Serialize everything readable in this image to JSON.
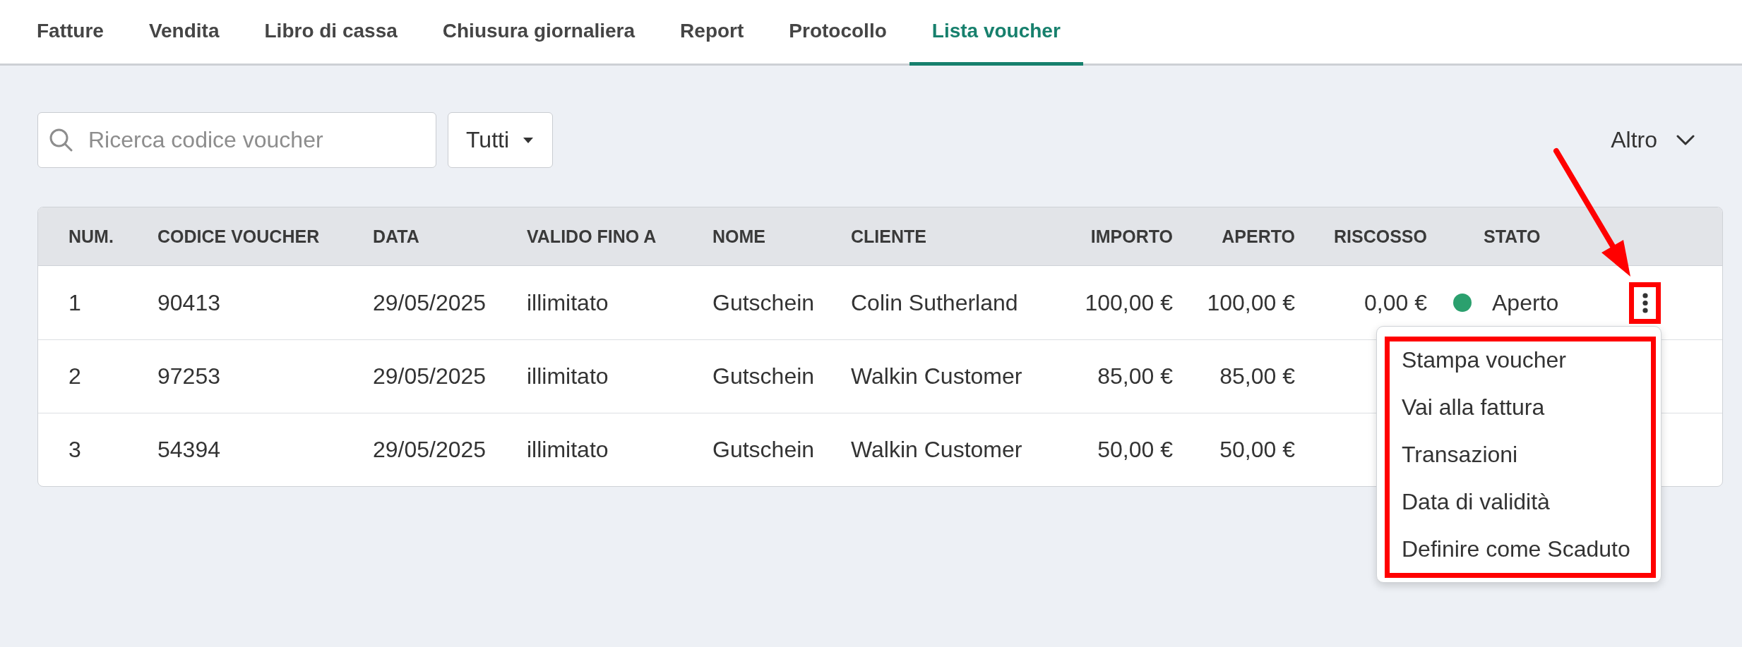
{
  "tabs": [
    {
      "label": "Fatture",
      "selected": false
    },
    {
      "label": "Vendita",
      "selected": false
    },
    {
      "label": "Libro di cassa",
      "selected": false
    },
    {
      "label": "Chiusura giornaliera",
      "selected": false
    },
    {
      "label": "Report",
      "selected": false
    },
    {
      "label": "Protocollo",
      "selected": false
    },
    {
      "label": "Lista voucher",
      "selected": true
    }
  ],
  "toolbar": {
    "search": {
      "placeholder": "Ricerca codice voucher"
    },
    "filter": {
      "value": "Tutti"
    },
    "more": {
      "label": "Altro"
    }
  },
  "table": {
    "columns": [
      "NUM.",
      "CODICE VOUCHER",
      "DATA",
      "VALIDO FINO A",
      "NOME",
      "CLIENTE",
      "IMPORTO",
      "APERTO",
      "RISCOSSO",
      "STATO"
    ],
    "rows": [
      {
        "num": "1",
        "code": "90413",
        "date": "29/05/2025",
        "valid_until": "illimitato",
        "name": "Gutschein",
        "customer": "Colin Sutherland",
        "amount": "100,00 €",
        "open": "100,00 €",
        "collected": "0,00 €",
        "status": {
          "label": "Aperto",
          "color": "#2ba06e"
        },
        "menu": [
          "Stampa voucher",
          "Vai alla fattura",
          "Transazioni",
          "Data di validità",
          "Definire come Scaduto"
        ]
      },
      {
        "num": "2",
        "code": "97253",
        "date": "29/05/2025",
        "valid_until": "illimitato",
        "name": "Gutschein",
        "customer": "Walkin Customer",
        "amount": "85,00 €",
        "open": "85,00 €"
      },
      {
        "num": "3",
        "code": "54394",
        "date": "29/05/2025",
        "valid_until": "illimitato",
        "name": "Gutschein",
        "customer": "Walkin Customer",
        "amount": "50,00 €",
        "open": "50,00 €"
      }
    ]
  }
}
